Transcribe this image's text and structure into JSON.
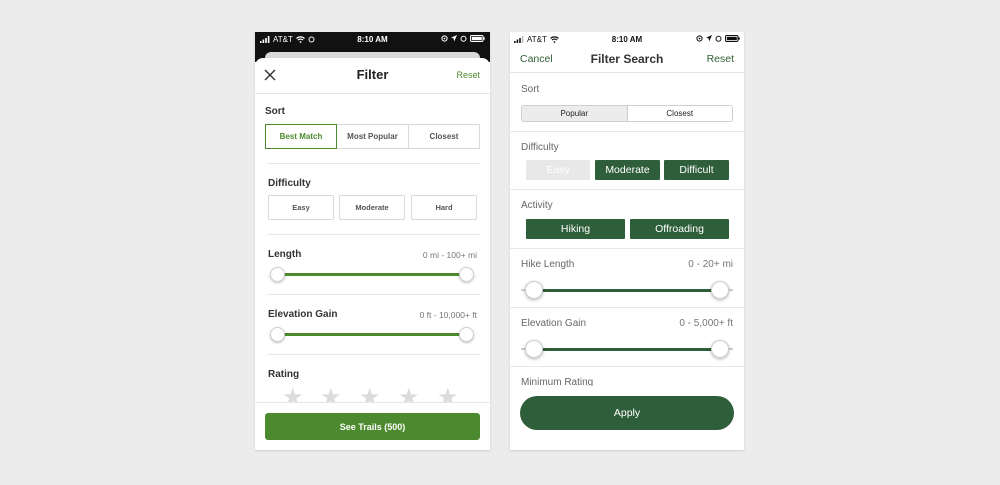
{
  "screen1": {
    "status": {
      "carrier": "AT&T",
      "time": "8:10 AM"
    },
    "header": {
      "title": "Filter",
      "reset": "Reset"
    },
    "sort": {
      "label": "Sort",
      "options": [
        "Best Match",
        "Most Popular",
        "Closest"
      ],
      "selected": "Best Match"
    },
    "difficulty": {
      "label": "Difficulty",
      "options": [
        "Easy",
        "Moderate",
        "Hard"
      ]
    },
    "length": {
      "label": "Length",
      "range": "0 mi - 100+ mi",
      "min_fraction": 0,
      "max_fraction": 1
    },
    "elevation": {
      "label": "Elevation Gain",
      "range": "0 ft - 10,000+ ft",
      "min_fraction": 0,
      "max_fraction": 1
    },
    "rating": {
      "label": "Rating",
      "stars": 5
    },
    "footer": {
      "cta": "See Trails (500)"
    },
    "colors": {
      "accent": "#4d8a2f"
    }
  },
  "screen2": {
    "status": {
      "carrier": "AT&T",
      "time": "8:10 AM"
    },
    "nav": {
      "cancel": "Cancel",
      "title": "Filter Search",
      "reset": "Reset"
    },
    "sort": {
      "label": "Sort",
      "options": [
        "Popular",
        "Closest"
      ],
      "selected": "Closest"
    },
    "difficulty": {
      "label": "Difficulty",
      "options": [
        "Easy",
        "Moderate",
        "Difficult"
      ],
      "selected": [
        "Moderate",
        "Difficult"
      ]
    },
    "activity": {
      "label": "Activity",
      "options": [
        "Hiking",
        "Offroading"
      ],
      "selected": [
        "Hiking",
        "Offroading"
      ]
    },
    "hike_length": {
      "label": "Hike Length",
      "range": "0 - 20+ mi",
      "min_fraction": 0,
      "max_fraction": 1
    },
    "elevation": {
      "label": "Elevation Gain",
      "range": "0 - 5,000+ ft",
      "min_fraction": 0,
      "max_fraction": 1
    },
    "min_rating": {
      "label": "Minimum Rating"
    },
    "apply": "Apply",
    "colors": {
      "accent": "#2f5f3a"
    }
  }
}
